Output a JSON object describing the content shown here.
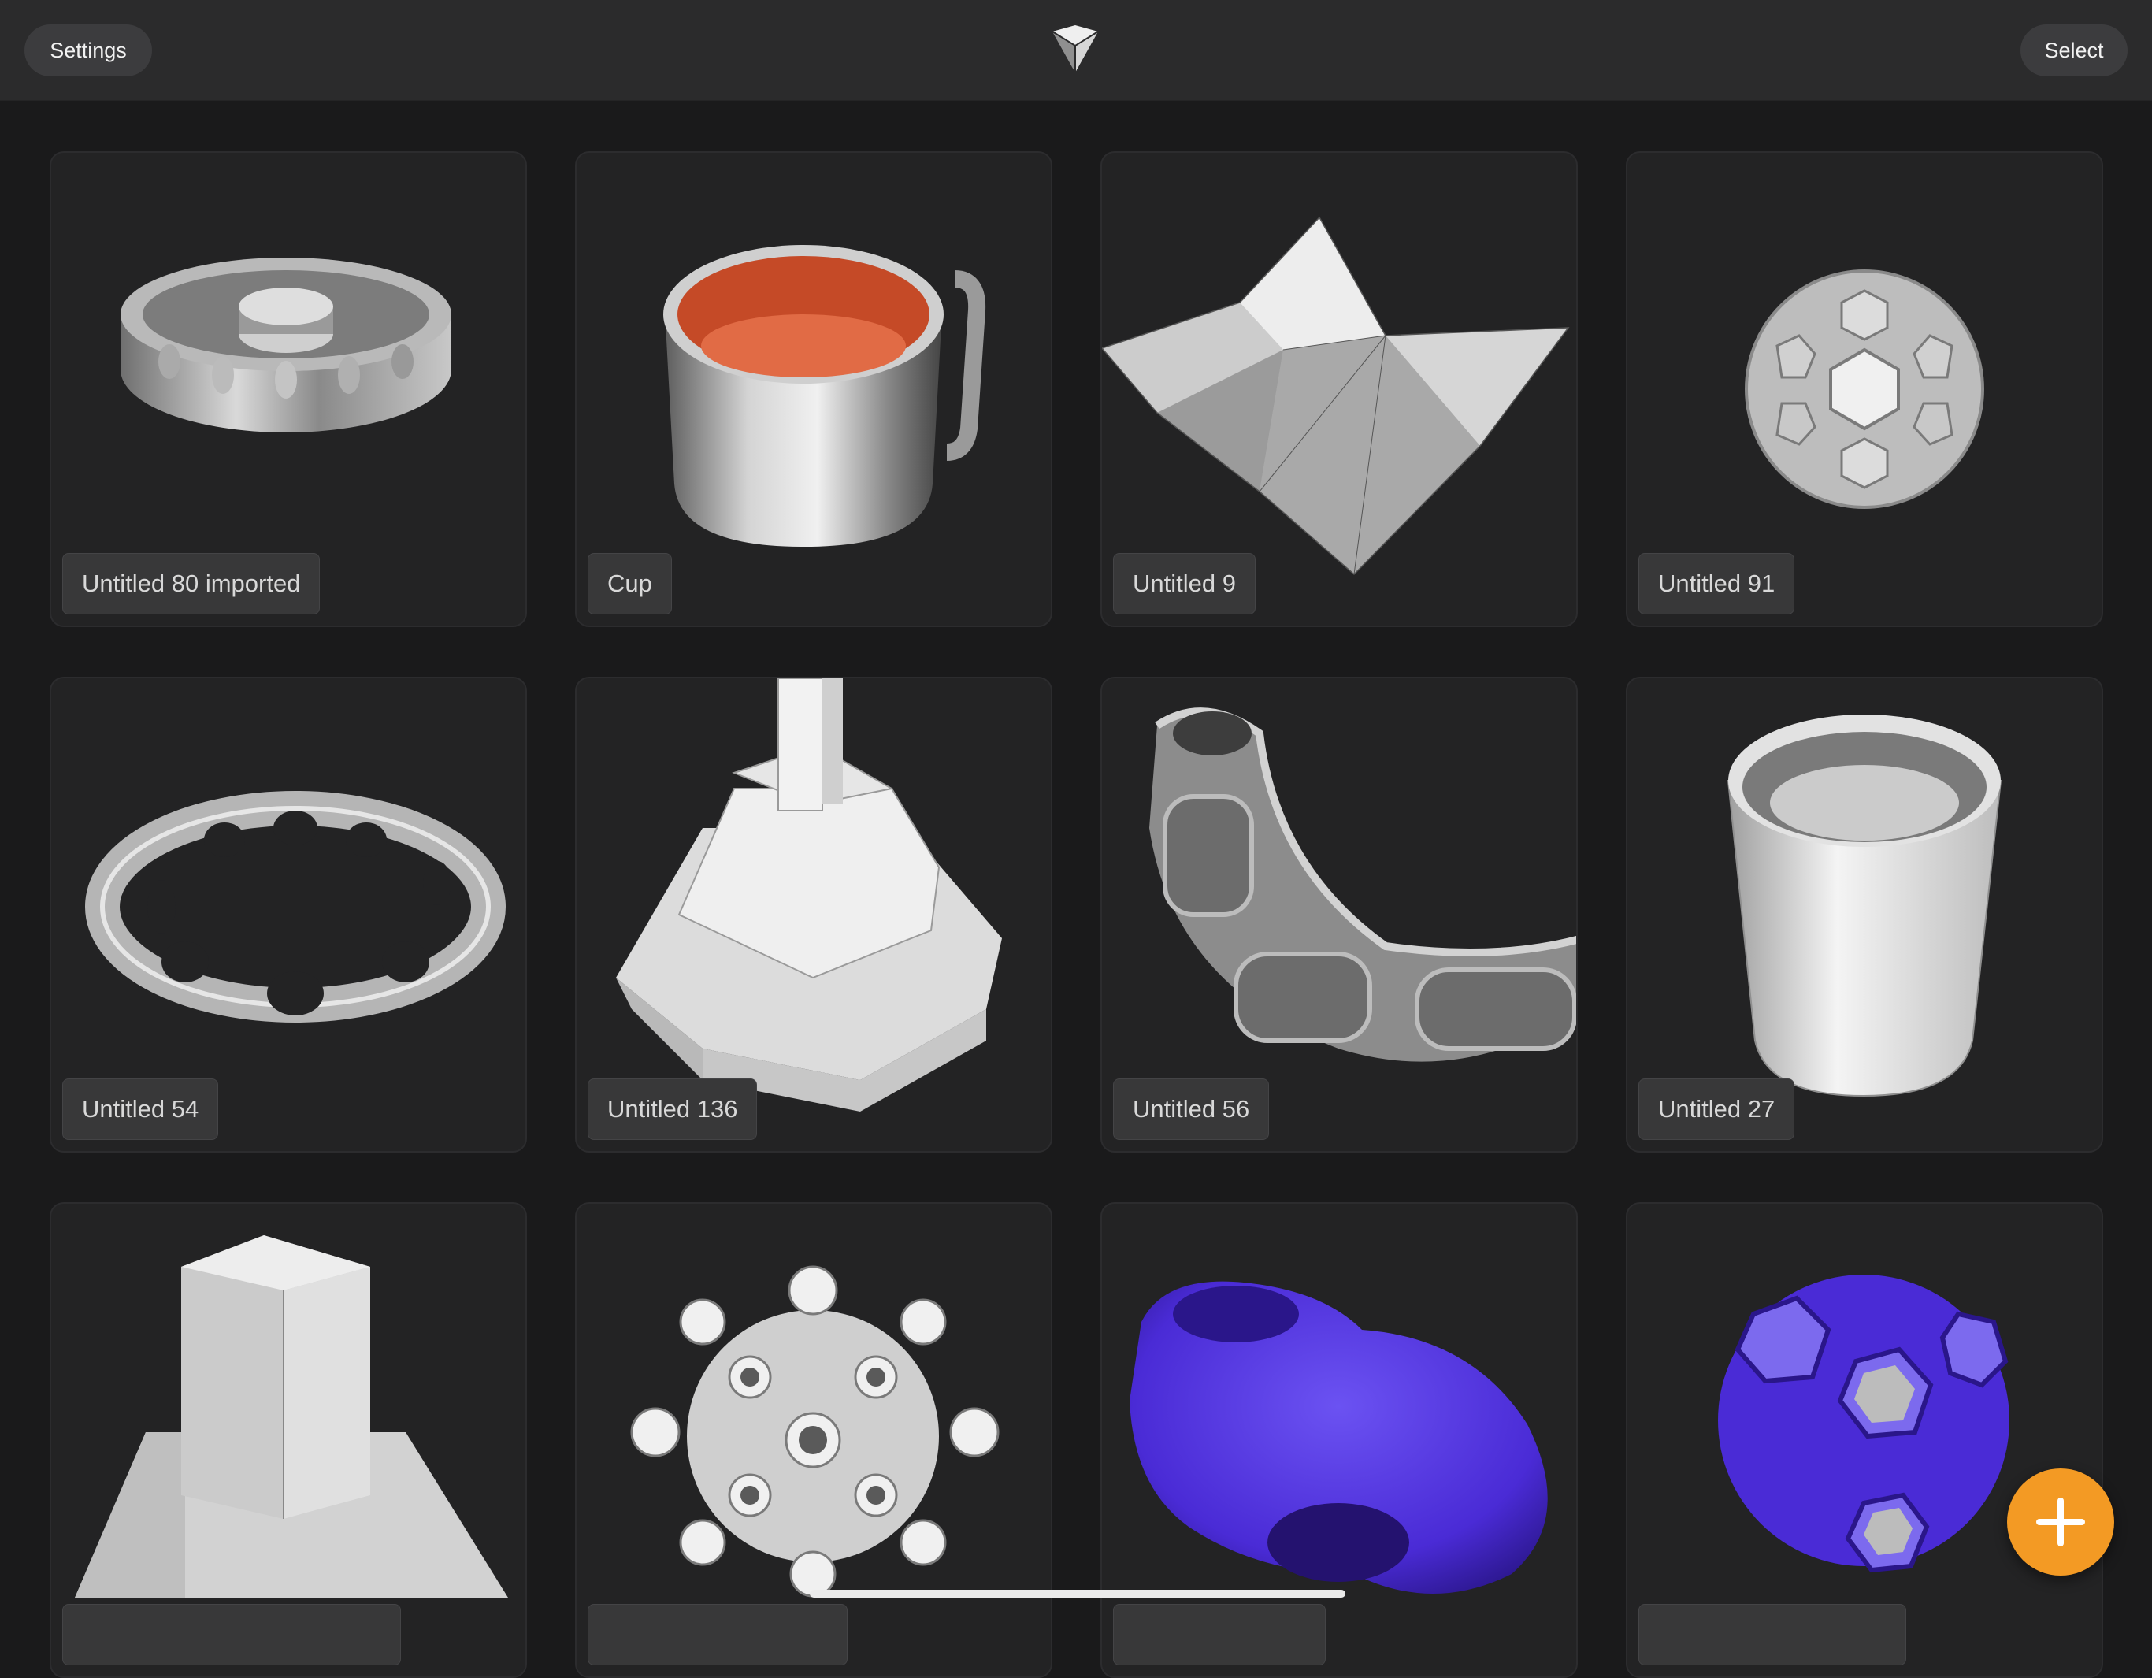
{
  "topbar": {
    "settings_label": "Settings",
    "select_label": "Select",
    "logo_icon": "app-logo-icon"
  },
  "gallery": {
    "items": [
      {
        "label": "Untitled 80 imported",
        "thumbnail": "silver-ring-box-thumbnail"
      },
      {
        "label": "Cup",
        "thumbnail": "cup-thumbnail"
      },
      {
        "label": "Untitled 9",
        "thumbnail": "low-poly-terrain-thumbnail"
      },
      {
        "label": "Untitled 91",
        "thumbnail": "polyhedron-ball-thumbnail"
      },
      {
        "label": "Untitled 54",
        "thumbnail": "perforated-ring-thumbnail"
      },
      {
        "label": "Untitled 136",
        "thumbnail": "pedestal-thumbnail"
      },
      {
        "label": "Untitled 56",
        "thumbnail": "curved-dish-thumbnail"
      },
      {
        "label": "Untitled 27",
        "thumbnail": "tumbler-thumbnail"
      },
      {
        "label": "",
        "thumbnail": "block-thumbnail"
      },
      {
        "label": "",
        "thumbnail": "spiky-ball-thumbnail"
      },
      {
        "label": "",
        "thumbnail": "blue-blob-thumbnail"
      },
      {
        "label": "",
        "thumbnail": "blue-polyhedron-thumbnail"
      }
    ]
  },
  "fab": {
    "icon": "plus-icon"
  },
  "colors": {
    "background": "#1a1a1b",
    "topbar": "#2b2b2c",
    "card": "#232324",
    "accent": "#f39a24",
    "model_blue": "#4a2bd6"
  }
}
